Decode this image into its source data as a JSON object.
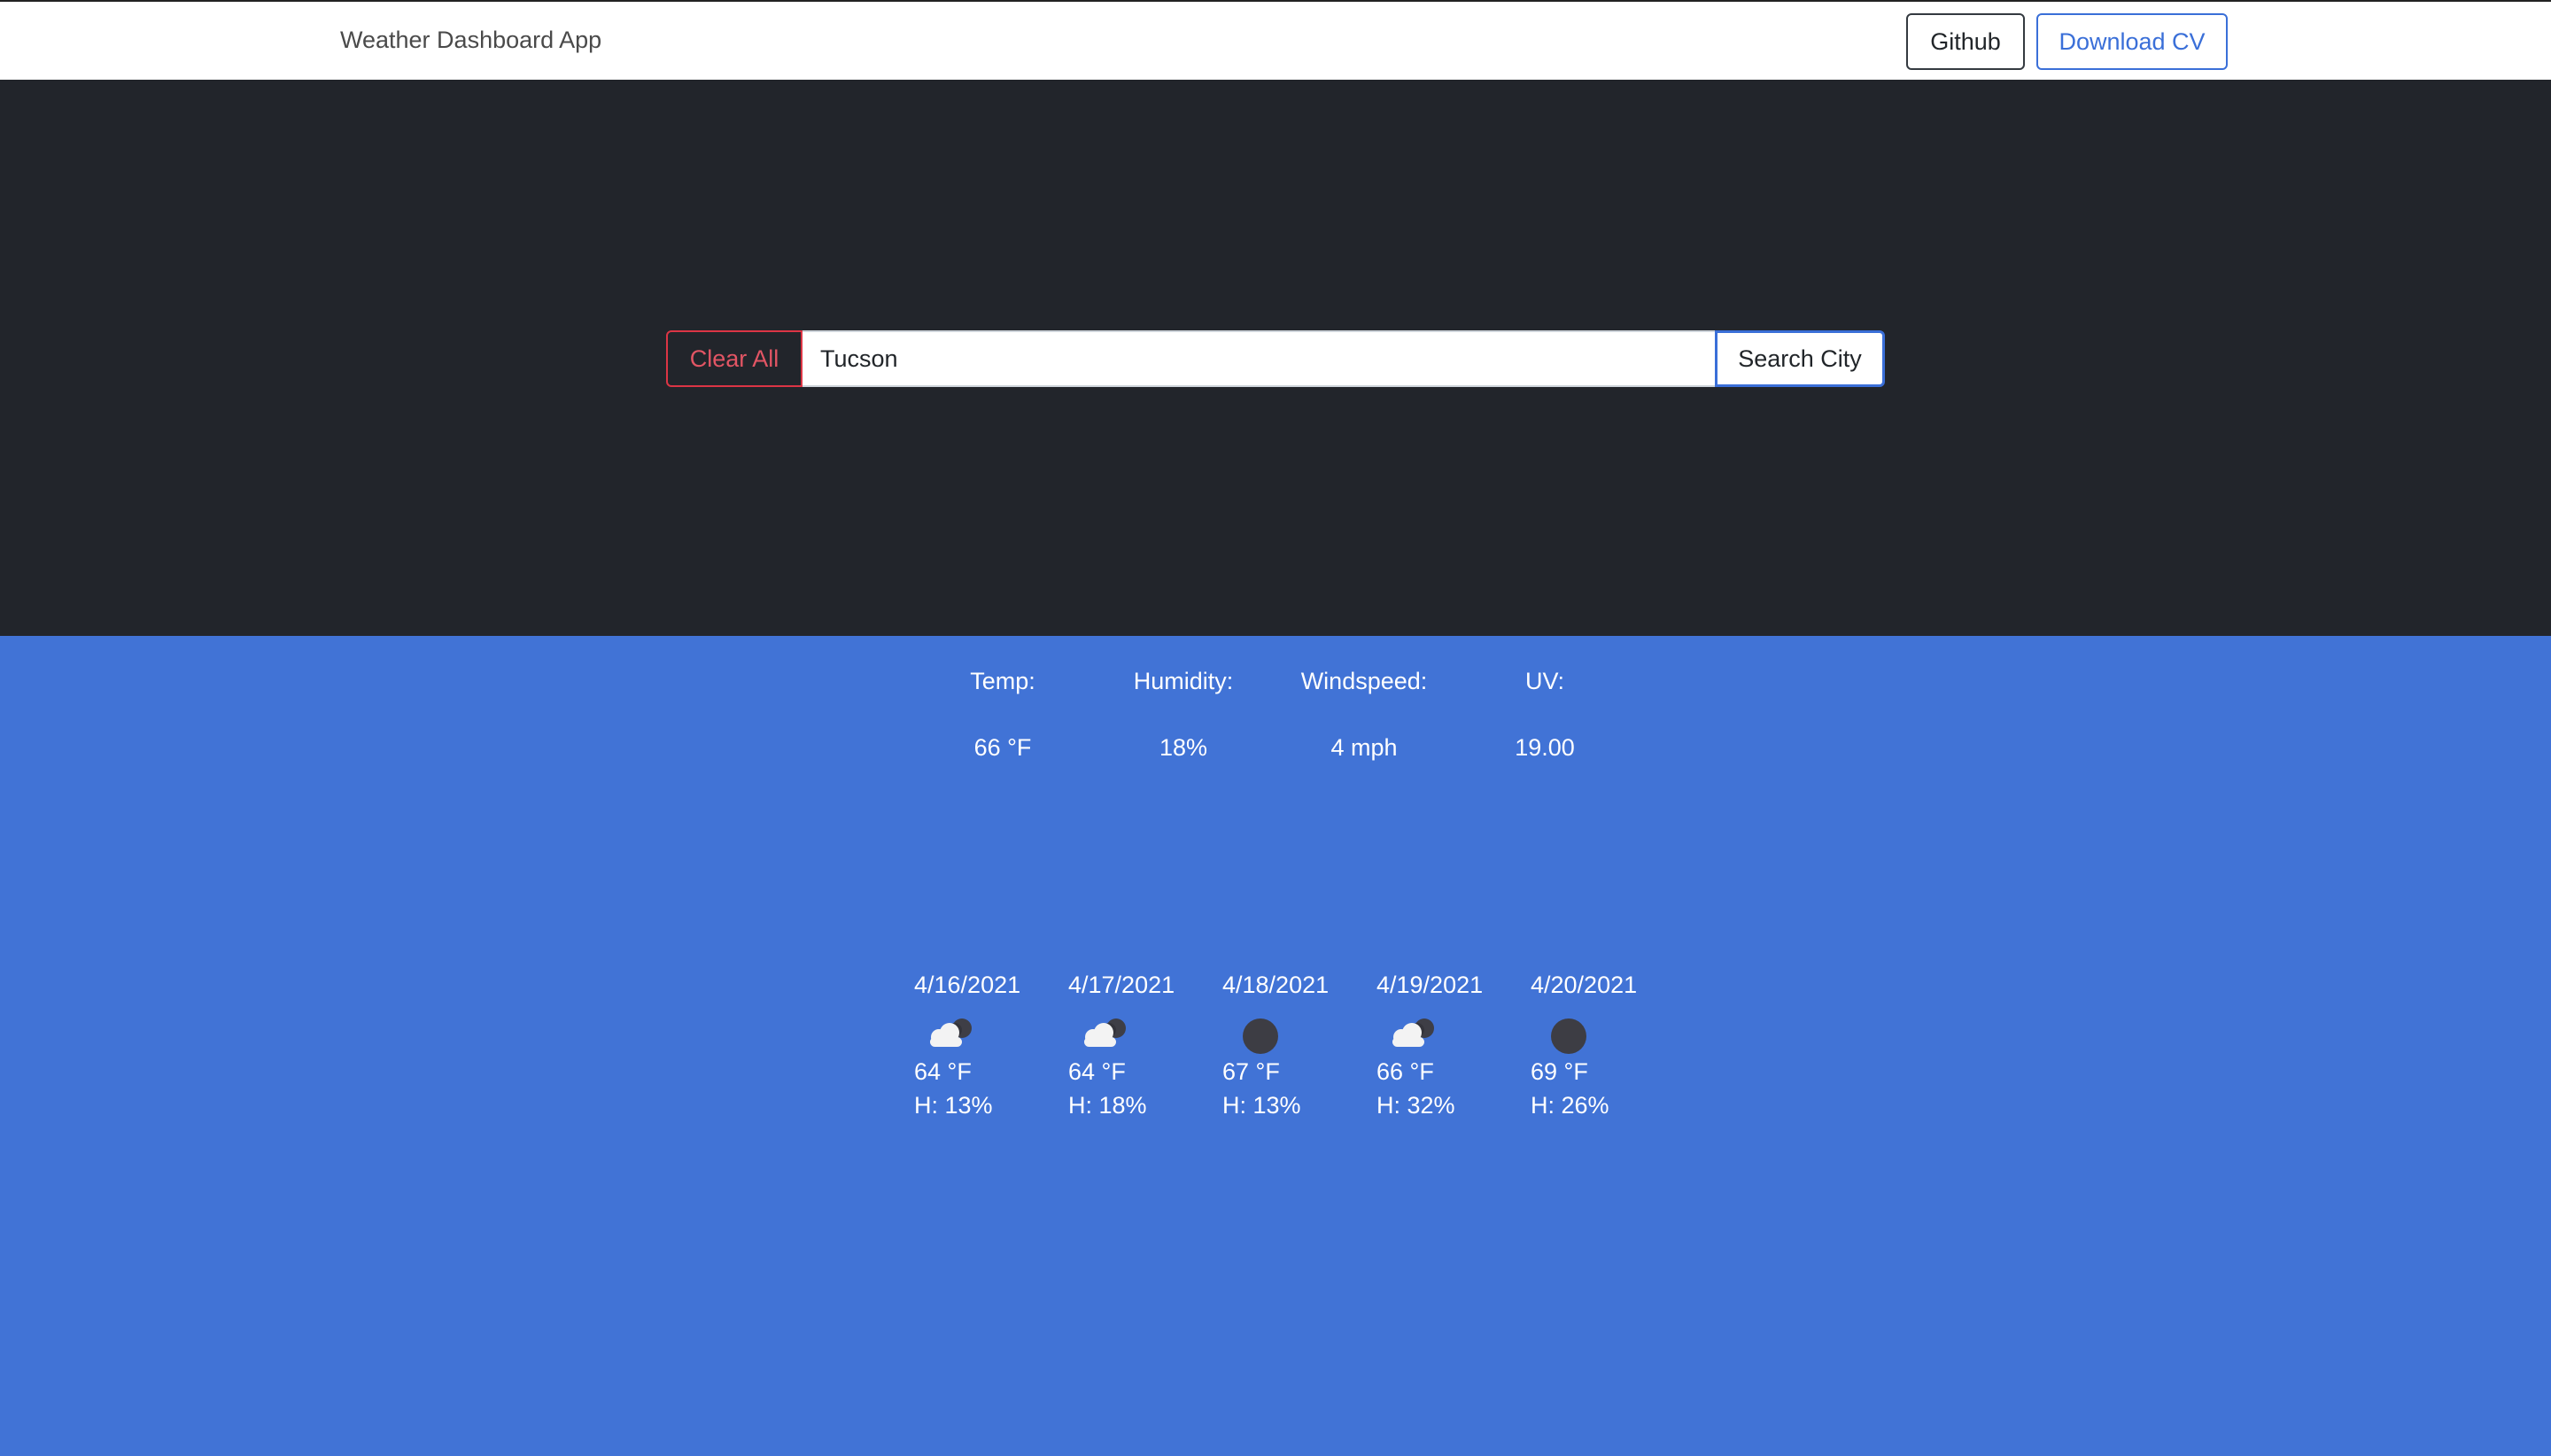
{
  "navbar": {
    "brand": "Weather Dashboard App",
    "github_label": "Github",
    "cv_label": "Download CV"
  },
  "search": {
    "clear_label": "Clear All",
    "value": "Tucson",
    "button_label": "Search City"
  },
  "current": {
    "stats": [
      {
        "label": "Temp:",
        "value": "66 °F"
      },
      {
        "label": "Humidity:",
        "value": "18%"
      },
      {
        "label": "Windspeed:",
        "value": "4 mph"
      },
      {
        "label": "UV:",
        "value": "19.00"
      }
    ]
  },
  "forecast": [
    {
      "date": "4/16/2021",
      "icon": "partly-cloudy-night-icon",
      "temp": "64 °F",
      "humidity": "H: 13%"
    },
    {
      "date": "4/17/2021",
      "icon": "partly-cloudy-night-icon",
      "temp": "64 °F",
      "humidity": "H: 18%"
    },
    {
      "date": "4/18/2021",
      "icon": "clear-night-icon",
      "temp": "67 °F",
      "humidity": "H: 13%"
    },
    {
      "date": "4/19/2021",
      "icon": "partly-cloudy-night-icon",
      "temp": "66 °F",
      "humidity": "H: 32%"
    },
    {
      "date": "4/20/2021",
      "icon": "clear-night-icon",
      "temp": "69 °F",
      "humidity": "H: 26%"
    }
  ],
  "colors": {
    "navbar_bg": "#ffffff",
    "hero_bg": "#22252b",
    "content_bg": "#4173d6",
    "danger": "#dc3545",
    "primary": "#3a6fd8"
  }
}
